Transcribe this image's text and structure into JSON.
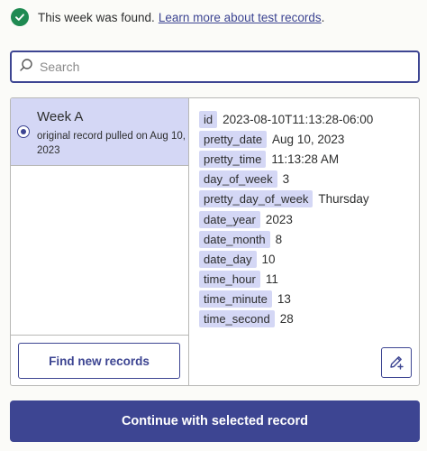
{
  "notice": {
    "message": "This week was found.",
    "link_text": "Learn more about test records",
    "link_suffix": "."
  },
  "search": {
    "placeholder": "Search",
    "value": ""
  },
  "records": [
    {
      "title": "Week A",
      "subtitle": "original record pulled on Aug 10, 2023",
      "selected": true
    }
  ],
  "find_button_label": "Find new records",
  "fields": [
    {
      "key": "id",
      "value": "2023-08-10T11:13:28-06:00"
    },
    {
      "key": "pretty_date",
      "value": "Aug 10, 2023"
    },
    {
      "key": "pretty_time",
      "value": "11:13:28 AM"
    },
    {
      "key": "day_of_week",
      "value": "3"
    },
    {
      "key": "pretty_day_of_week",
      "value": "Thursday"
    },
    {
      "key": "date_year",
      "value": "2023"
    },
    {
      "key": "date_month",
      "value": "8"
    },
    {
      "key": "date_day",
      "value": "10"
    },
    {
      "key": "time_hour",
      "value": "11"
    },
    {
      "key": "time_minute",
      "value": "13"
    },
    {
      "key": "time_second",
      "value": "28"
    }
  ],
  "continue_button_label": "Continue with selected record",
  "colors": {
    "accent": "#3d4592",
    "success": "#1f8a52",
    "selected_bg": "#d4d7f5",
    "border": "#b8b8b6"
  }
}
